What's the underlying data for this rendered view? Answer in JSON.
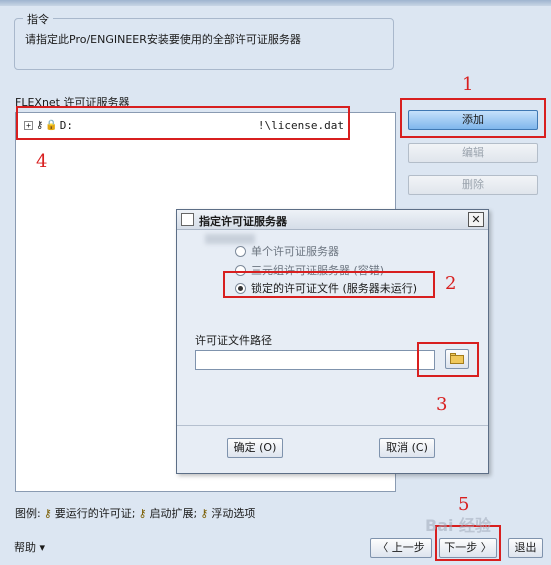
{
  "instruction_group": {
    "title": "指令",
    "text": "请指定此Pro/ENGINEER安装要使用的全部许可证服务器"
  },
  "server_list": {
    "label": "FLEXnet 许可证服务器",
    "items": [
      {
        "expander": "+",
        "name": "D:",
        "path": "!\\license.dat"
      }
    ]
  },
  "side_buttons": {
    "add": "添加",
    "edit": "编辑",
    "delete": "删除"
  },
  "dialog": {
    "title": "指定许可证服务器",
    "close": "✕",
    "options": [
      {
        "label": "单个许可证服务器",
        "selected": false
      },
      {
        "label": "三元组许可证服务器 (容错)",
        "selected": false
      },
      {
        "label": "锁定的许可证文件 (服务器未运行)",
        "selected": true
      }
    ],
    "path_label": "许可证文件路径",
    "path_value": "",
    "ok": "确定 (O)",
    "cancel": "取消 (C)"
  },
  "legend": {
    "prefix": "图例:",
    "running": "要运行的许可证;",
    "extension": "启动扩展;",
    "floating": "浮动选项"
  },
  "footer": {
    "help": "帮助 ▾",
    "back": "〈 上一步",
    "next": "下一步 〉",
    "exit": "退出"
  },
  "annotations": [
    "1",
    "2",
    "3",
    "4",
    "5"
  ],
  "watermark": "Bai 经验",
  "colors": {
    "annotation_red": "#d81f1f",
    "primary_button": "#7fb6ec"
  }
}
